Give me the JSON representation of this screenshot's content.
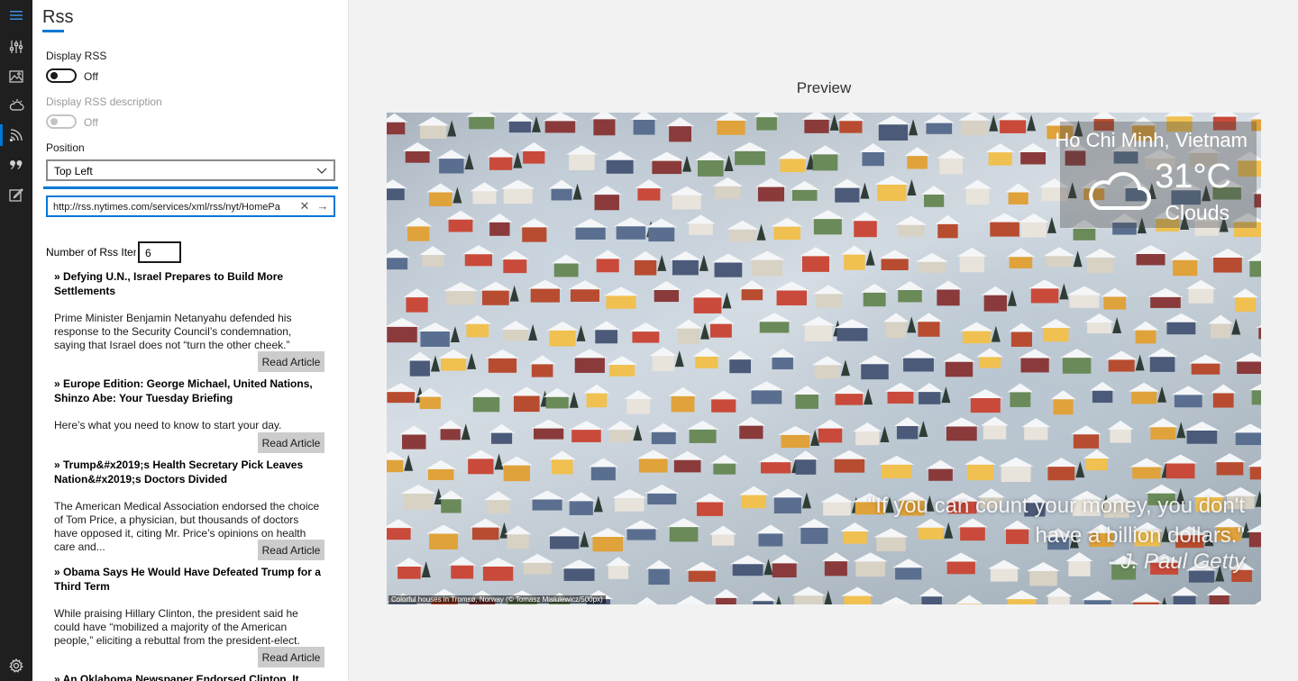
{
  "pane": {
    "title": "Rss",
    "display_rss": {
      "label": "Display RSS",
      "state": "Off"
    },
    "display_rss_description": {
      "label": "Display RSS description",
      "state": "Off"
    },
    "position": {
      "label": "Position",
      "selected": "Top Left"
    },
    "feed_url": "http://rss.nytimes.com/services/xml/rss/nyt/HomePa",
    "count": {
      "label": "Number of Rss Item",
      "value": "6"
    },
    "read_label": "Read Article",
    "articles": [
      {
        "headline": "» Defying U.N., Israel Prepares to Build More Settlements",
        "desc": "Prime Minister Benjamin Netanyahu defended his response to the Security Council’s condemnation, saying that Israel does not “turn the other cheek.”"
      },
      {
        "headline": "» Europe Edition: George Michael, United Nations, Shinzo Abe: Your Tuesday Briefing",
        "desc": "Here’s what you need to know to start your day."
      },
      {
        "headline": "» Trump&#x2019;s Health Secretary Pick Leaves Nation&#x2019;s Doctors Divided",
        "desc": "The American Medical Association endorsed the choice of Tom Price, a physician, but thousands of doctors have opposed it, citing Mr. Price’s opinions on health care and..."
      },
      {
        "headline": "» Obama Says He Would Have Defeated Trump for a Third Term",
        "desc": "While praising Hillary Clinton, the president said he could have “mobilized a majority of the American people,” eliciting a rebuttal from the president-elect."
      },
      {
        "headline": "» An Oklahoma Newspaper Endorsed Clinton. It",
        "desc": ""
      }
    ]
  },
  "preview": {
    "title": "Preview",
    "weather": {
      "city": "Ho Chi Minh, Vietnam",
      "temp": "31°C",
      "condition": "Clouds"
    },
    "quote": "\"If you can count your money, you don't have a billion dollars.\"",
    "author": "- J. Paul Getty",
    "caption": "Colorful houses in Tromsø, Norway (© Tomasz Misiulewicz/500px)"
  },
  "colors": {
    "accent": "#0078d7",
    "rail": "#1f1f1f"
  },
  "rail_icons": [
    "hamburger-icon",
    "sliders-icon",
    "image-icon",
    "weather-icon",
    "rss-icon",
    "quote-icon",
    "edit-icon",
    "settings-icon"
  ]
}
